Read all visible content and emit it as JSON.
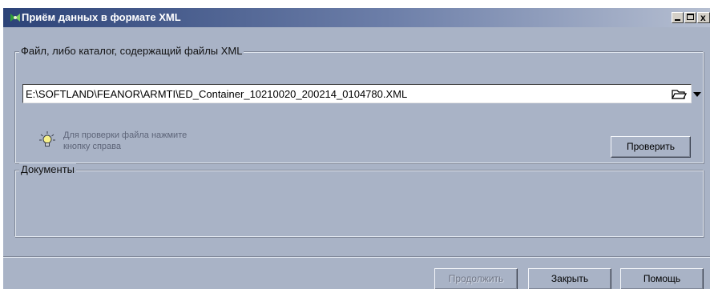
{
  "window": {
    "title": "Приём данных в формате XML",
    "icon": "xml-import-icon",
    "controls": {
      "minimize": "minimize-icon",
      "maximize": "maximize-icon",
      "close": "close-icon",
      "close_glyph": "x"
    }
  },
  "file_group": {
    "legend": "Файл, либо каталог, содержащий файлы XML",
    "path_value": "E:\\SOFTLAND\\FEANOR\\ARMTI\\ED_Container_10210020_200214_0104780.XML",
    "browse_icon": "folder-open-icon",
    "dropdown_icon": "chevron-down-icon",
    "hint_icon": "lightbulb-icon",
    "hint_line1": "Для проверки файла нажмите",
    "hint_line2": "кнопку справа",
    "check_button": "Проверить"
  },
  "documents_group": {
    "legend": "Документы"
  },
  "footer": {
    "continue_button": "Продолжить",
    "continue_enabled": false,
    "close_button": "Закрыть",
    "help_button": "Помощь"
  },
  "colors": {
    "window_bg": "#a9b3c6",
    "title_start": "#2c4378",
    "title_end": "#b6bfd1",
    "hint_text": "#5d6478"
  }
}
